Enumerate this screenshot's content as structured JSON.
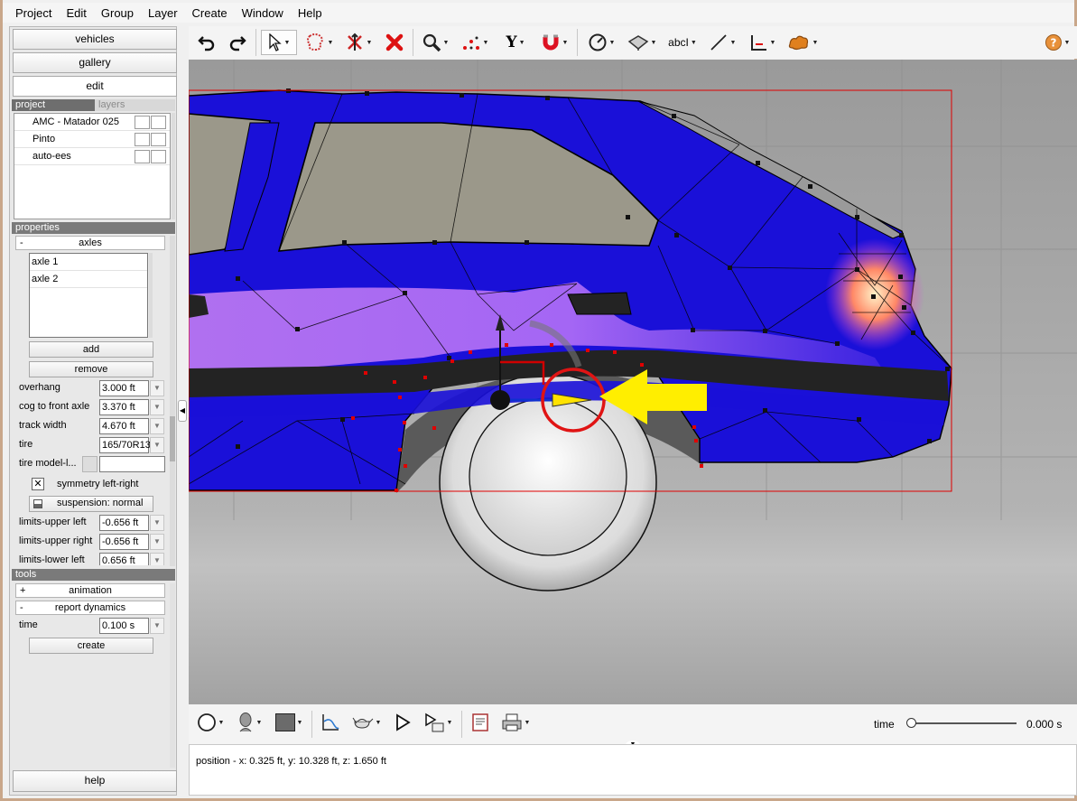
{
  "menu": [
    "Project",
    "Edit",
    "Group",
    "Layer",
    "Create",
    "Window",
    "Help"
  ],
  "nav": {
    "vehicles": "vehicles",
    "gallery": "gallery",
    "edit": "edit",
    "help": "help"
  },
  "tabs": {
    "project": "project",
    "layers": "layers"
  },
  "projects": [
    "AMC - Matador 025",
    "Pinto",
    "auto-ees"
  ],
  "properties": {
    "header": "properties",
    "group": "axles",
    "group_toggle": "-",
    "axles": [
      "axle 1",
      "axle 2"
    ],
    "add": "add",
    "remove": "remove",
    "fields": [
      {
        "label": "overhang",
        "value": "3.000 ft"
      },
      {
        "label": "cog to front axle",
        "value": "3.370 ft"
      },
      {
        "label": "track width",
        "value": "4.670 ft"
      },
      {
        "label": "tire",
        "value": "165/70R13"
      },
      {
        "label": "tire model-l...",
        "value": ""
      }
    ],
    "symmetry": "symmetry left-right",
    "symmetry_check": "✕",
    "suspension": "suspension: normal",
    "limits": [
      {
        "label": "limits-upper left",
        "value": "-0.656 ft"
      },
      {
        "label": "limits-upper right",
        "value": "-0.656 ft"
      },
      {
        "label": "limits-lower left",
        "value": "0.656 ft"
      }
    ]
  },
  "tools": {
    "header": "tools",
    "animation": "animation",
    "animation_toggle": "+",
    "report": "report dynamics",
    "report_toggle": "-",
    "time_label": "time",
    "time_value": "0.100 s",
    "create": "create"
  },
  "toolbar": {
    "text_tool": "abc"
  },
  "bottom": {
    "time_label": "time",
    "time_value": "0.000 s",
    "slider_fraction": 0
  },
  "status": "position - x: 0.325 ft, y: 10.328 ft, z: 1.650 ft",
  "colors": {
    "body": "#1a10d8",
    "stripe": "#b06cf0",
    "selection": "#e00000",
    "arrow": "#ffee00"
  }
}
